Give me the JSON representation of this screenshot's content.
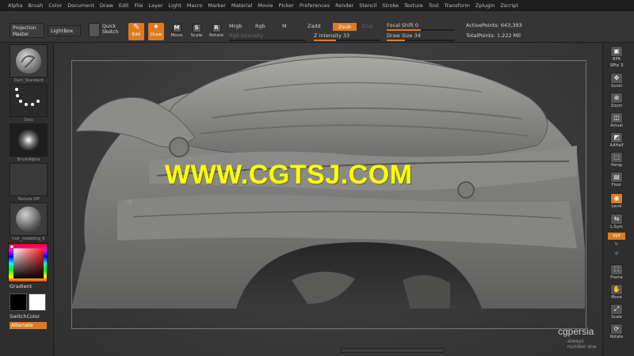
{
  "menu": [
    "Alpha",
    "Brush",
    "Color",
    "Document",
    "Draw",
    "Edit",
    "File",
    "Layer",
    "Light",
    "Macro",
    "Marker",
    "Material",
    "Movie",
    "Picker",
    "Preferences",
    "Render",
    "Stencil",
    "Stroke",
    "Texture",
    "Tool",
    "Transform",
    "Zplugin",
    "Zscript"
  ],
  "shelf": {
    "projection_master_line1": "Projection",
    "projection_master_line2": "Master",
    "lightbox": "LightBox",
    "quick_sketch_line1": "Quick",
    "quick_sketch_line2": "Sketch",
    "edit": "Edit",
    "draw": "Draw",
    "move": "Move",
    "scale": "Scale",
    "rotate": "Rotate",
    "m_glyph": "M",
    "s_glyph": "S",
    "r_glyph": "R",
    "mrgb": "Mrgb",
    "rgb": "Rgb",
    "m": "M",
    "rgb_intensity": "Rgb Intensity",
    "zadd": "Zadd",
    "zsub": "Zsub",
    "zcut": "Zcut",
    "z_intensity_label": "Z Intensity",
    "z_intensity_value": "33",
    "focal_shift_label": "Focal Shift",
    "focal_shift_value": "0",
    "draw_size_label": "Draw Size",
    "draw_size_value": "34",
    "active_points_label": "ActivePoints:",
    "active_points_value": "643,393",
    "total_points_label": "TotalPoints:",
    "total_points_value": "1.222 Mil",
    "z_intensity_fraction": 0.33,
    "draw_size_fraction": 0.27,
    "focal_shift_fraction": 0.5
  },
  "left_tray": {
    "brush_label": "Dam_Standard",
    "stroke_label": "Dots",
    "alpha_label": "BrushAlpha",
    "texture_label": "Texture Off",
    "material_label": "hair_modeling_6",
    "gradient_label": "Gradient",
    "switch_color_label": "SwitchColor",
    "alternate_label": "Alternate"
  },
  "canvas": {
    "watermark": "WWW.CGTSJ.COM",
    "brand": "cgpersia",
    "brand_sub": "always number one"
  },
  "right_tray": {
    "bpr": "BPR",
    "spix": "SPix",
    "spix_value": "3",
    "scroll": "Scroll",
    "zoom": "Zoom",
    "actual": "Actual",
    "aahalf": "AAHalf",
    "persp": "Persp",
    "floor": "Floor",
    "local": "Local",
    "lsym": "L.Sym",
    "xyz": "xyz",
    "frame": "Frame",
    "move": "Move",
    "scale": "Scale",
    "rotate": "Rotate"
  },
  "colors": {
    "accent": "#e07a1f",
    "watermark": "#ffff00",
    "bg": "#2b2b2b"
  }
}
